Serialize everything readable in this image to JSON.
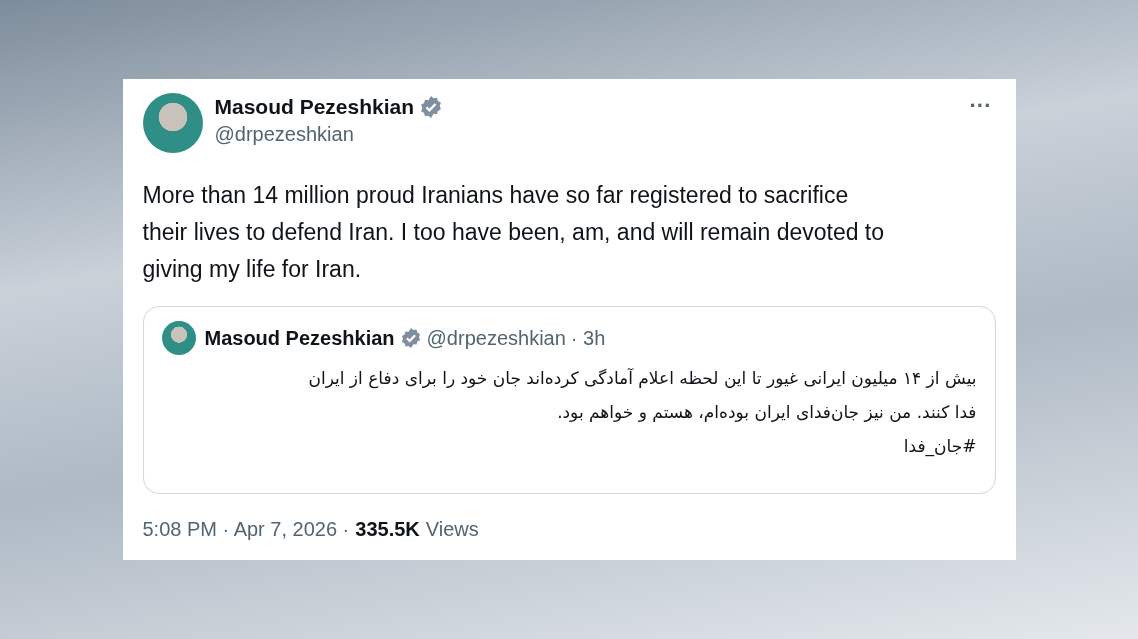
{
  "post": {
    "author": "Masoud Pezeshkian",
    "verified": true,
    "handle": "@drpezeshkian",
    "more": "···",
    "text_lines": [
      "More than 14 million proud Iranians have so far registered to sacrifice",
      "their lives to defend Iran. I too have been, am, and will remain devoted to",
      "giving my life for Iran."
    ],
    "quote": {
      "author": "Masoud Pezeshkian",
      "verified": true,
      "handle": "@drpezeshkian",
      "age": "· 3h",
      "text_lines": [
        "بیش از ۱۴ میلیون ایرانی غیور تا این لحظه اعلام آمادگی کرده‌اند جان خود را برای دفاع از ایران",
        "فدا کنند. من نیز جان‌فدای ایران بوده‌ام، هستم و خواهم بود.",
        "#جان_فدا"
      ]
    },
    "time": "5:08 PM · Apr 7, 2026 ·",
    "views_count": "335.5K",
    "views_label": "Views"
  }
}
